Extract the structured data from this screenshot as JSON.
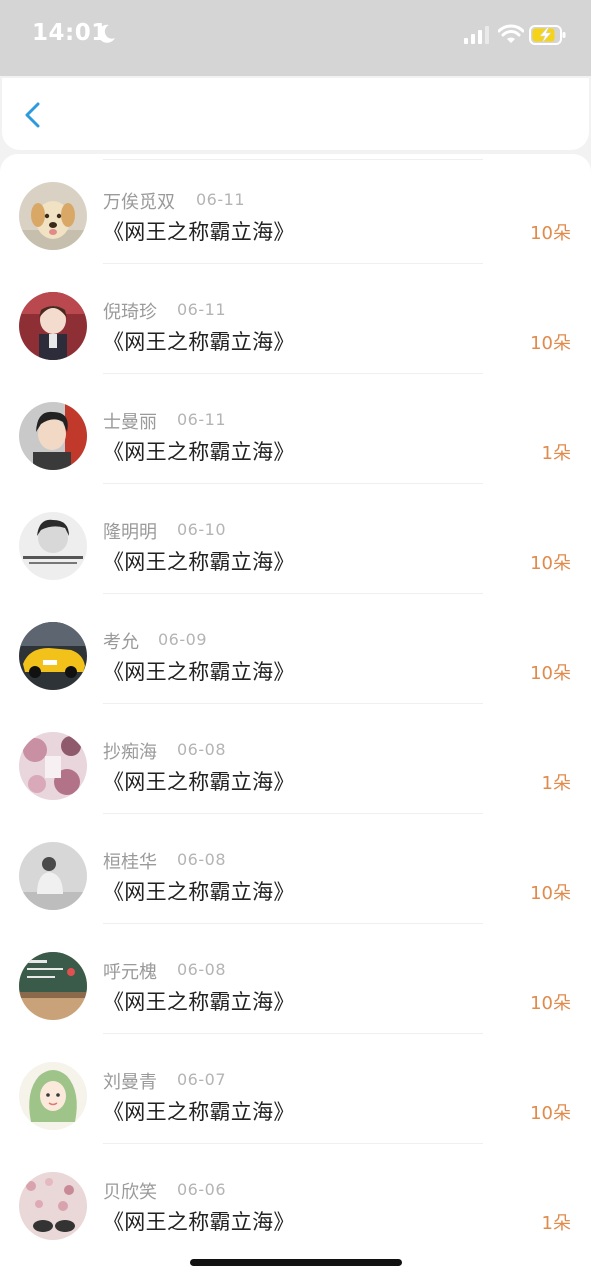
{
  "status_bar": {
    "time": "14:01",
    "icons": [
      "moon-icon",
      "signal-icon",
      "wifi-icon",
      "battery-charging-icon"
    ],
    "battery_color": "#f5d318"
  },
  "nav": {
    "back_icon": "chevron-left-icon",
    "accent_color": "#2d9ae0"
  },
  "list": {
    "count_color": "#e08a4c",
    "items": [
      {
        "name": "万俟觅双",
        "date": "06-11",
        "title": "《网王之称霸立海》",
        "count": "10朵",
        "avatar": "golden-dog"
      },
      {
        "name": "倪琦珍",
        "date": "06-11",
        "title": "《网王之称霸立海》",
        "count": "10朵",
        "avatar": "anime-boy-red"
      },
      {
        "name": "士曼丽",
        "date": "06-11",
        "title": "《网王之称霸立海》",
        "count": "1朵",
        "avatar": "boy-portrait"
      },
      {
        "name": "隆明明",
        "date": "06-10",
        "title": "《网王之称霸立海》",
        "count": "10朵",
        "avatar": "bw-portrait"
      },
      {
        "name": "考允",
        "date": "06-09",
        "title": "《网王之称霸立海》",
        "count": "10朵",
        "avatar": "yellow-car"
      },
      {
        "name": "抄痴海",
        "date": "06-08",
        "title": "《网王之称霸立海》",
        "count": "1朵",
        "avatar": "pink-flowers"
      },
      {
        "name": "桓桂华",
        "date": "06-08",
        "title": "《网王之称霸立海》",
        "count": "10朵",
        "avatar": "gray-person"
      },
      {
        "name": "呼元槐",
        "date": "06-08",
        "title": "《网王之称霸立海》",
        "count": "10朵",
        "avatar": "chalkboard"
      },
      {
        "name": "刘曼青",
        "date": "06-07",
        "title": "《网王之称霸立海》",
        "count": "10朵",
        "avatar": "green-hair-girl"
      },
      {
        "name": "贝欣笑",
        "date": "06-06",
        "title": "《网王之称霸立海》",
        "count": "1朵",
        "avatar": "sakura-shoes"
      }
    ]
  }
}
